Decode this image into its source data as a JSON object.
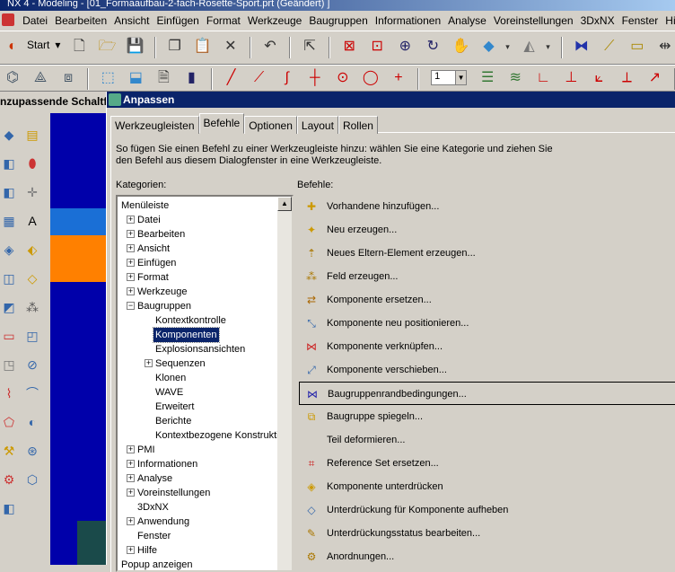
{
  "window": {
    "title": "NX 4 - Modeling - [01_Formaaufbau-2-fach-Rosette-Sport.prt (Geändert) ]"
  },
  "menubar": {
    "items": [
      "Datei",
      "Bearbeiten",
      "Ansicht",
      "Einfügen",
      "Format",
      "Werkzeuge",
      "Baugruppen",
      "Informationen",
      "Analyse",
      "Voreinstellungen",
      "3DxNX",
      "Fenster",
      "Hilfe"
    ]
  },
  "toolbar": {
    "start_label": "Start",
    "layer_value": "1"
  },
  "sidebar": {
    "header": "nzupassende Schaltfl"
  },
  "dialog": {
    "title": "Anpassen",
    "tabs": [
      "Werkzeugleisten",
      "Befehle",
      "Optionen",
      "Layout",
      "Rollen"
    ],
    "active_tab": "Befehle",
    "instructions": "So fügen Sie einen Befehl zu einer Werkzeugleiste hinzu: wählen Sie eine Kategorie und ziehen Sie\nden Befehl aus diesem Dialogfenster in eine Werkzeugleiste.",
    "categories_label": "Kategorien:",
    "commands_label": "Befehle:",
    "categories": [
      {
        "label": "Menüleiste",
        "level": 0,
        "expander": ""
      },
      {
        "label": "Datei",
        "level": 1,
        "expander": "+"
      },
      {
        "label": "Bearbeiten",
        "level": 1,
        "expander": "+"
      },
      {
        "label": "Ansicht",
        "level": 1,
        "expander": "+"
      },
      {
        "label": "Einfügen",
        "level": 1,
        "expander": "+"
      },
      {
        "label": "Format",
        "level": 1,
        "expander": "+"
      },
      {
        "label": "Werkzeuge",
        "level": 1,
        "expander": "+"
      },
      {
        "label": "Baugruppen",
        "level": 1,
        "expander": "−"
      },
      {
        "label": "Kontextkontrolle",
        "level": 2,
        "expander": ""
      },
      {
        "label": "Komponenten",
        "level": 2,
        "expander": "",
        "selected": true
      },
      {
        "label": "Explosionsansichten",
        "level": 2,
        "expander": ""
      },
      {
        "label": "Sequenzen",
        "level": 2,
        "expander": "+"
      },
      {
        "label": "Klonen",
        "level": 2,
        "expander": ""
      },
      {
        "label": "WAVE",
        "level": 2,
        "expander": ""
      },
      {
        "label": "Erweitert",
        "level": 2,
        "expander": ""
      },
      {
        "label": "Berichte",
        "level": 2,
        "expander": ""
      },
      {
        "label": "Kontextbezogene Konstruktio",
        "level": 2,
        "expander": ""
      },
      {
        "label": "PMI",
        "level": 1,
        "expander": "+"
      },
      {
        "label": "Informationen",
        "level": 1,
        "expander": "+"
      },
      {
        "label": "Analyse",
        "level": 1,
        "expander": "+"
      },
      {
        "label": "Voreinstellungen",
        "level": 1,
        "expander": "+"
      },
      {
        "label": "3DxNX",
        "level": 1,
        "expander": ""
      },
      {
        "label": "Anwendung",
        "level": 1,
        "expander": "+"
      },
      {
        "label": "Fenster",
        "level": 1,
        "expander": ""
      },
      {
        "label": "Hilfe",
        "level": 1,
        "expander": "+"
      },
      {
        "label": "Popup anzeigen",
        "level": 0,
        "expander": ""
      }
    ],
    "commands": [
      {
        "label": "Vorhandene hinzufügen...",
        "icon": "add-existing-icon"
      },
      {
        "label": "Neu erzeugen...",
        "icon": "create-new-icon"
      },
      {
        "label": "Neues Eltern-Element erzeugen...",
        "icon": "new-parent-icon"
      },
      {
        "label": "Feld erzeugen...",
        "icon": "array-icon"
      },
      {
        "label": "Komponente ersetzen...",
        "icon": "replace-component-icon"
      },
      {
        "label": "Komponente neu positionieren...",
        "icon": "reposition-icon"
      },
      {
        "label": "Komponente verknüpfen...",
        "icon": "mate-component-icon"
      },
      {
        "label": "Komponente verschieben...",
        "icon": "move-component-icon"
      },
      {
        "label": "Baugruppenrandbedingungen...",
        "icon": "assembly-constraints-icon",
        "focused": true
      },
      {
        "label": "Baugruppe spiegeln...",
        "icon": "mirror-assembly-icon"
      },
      {
        "label": "Teil deformieren...",
        "icon": ""
      },
      {
        "label": "Reference Set ersetzen...",
        "icon": "reference-set-icon"
      },
      {
        "label": "Komponente unterdrücken",
        "icon": "suppress-icon"
      },
      {
        "label": "Unterdrückung für Komponente aufheben",
        "icon": "unsuppress-icon"
      },
      {
        "label": "Unterdrückungsstatus bearbeiten...",
        "icon": "edit-suppression-icon"
      },
      {
        "label": "Anordnungen...",
        "icon": "arrangements-icon"
      }
    ]
  }
}
